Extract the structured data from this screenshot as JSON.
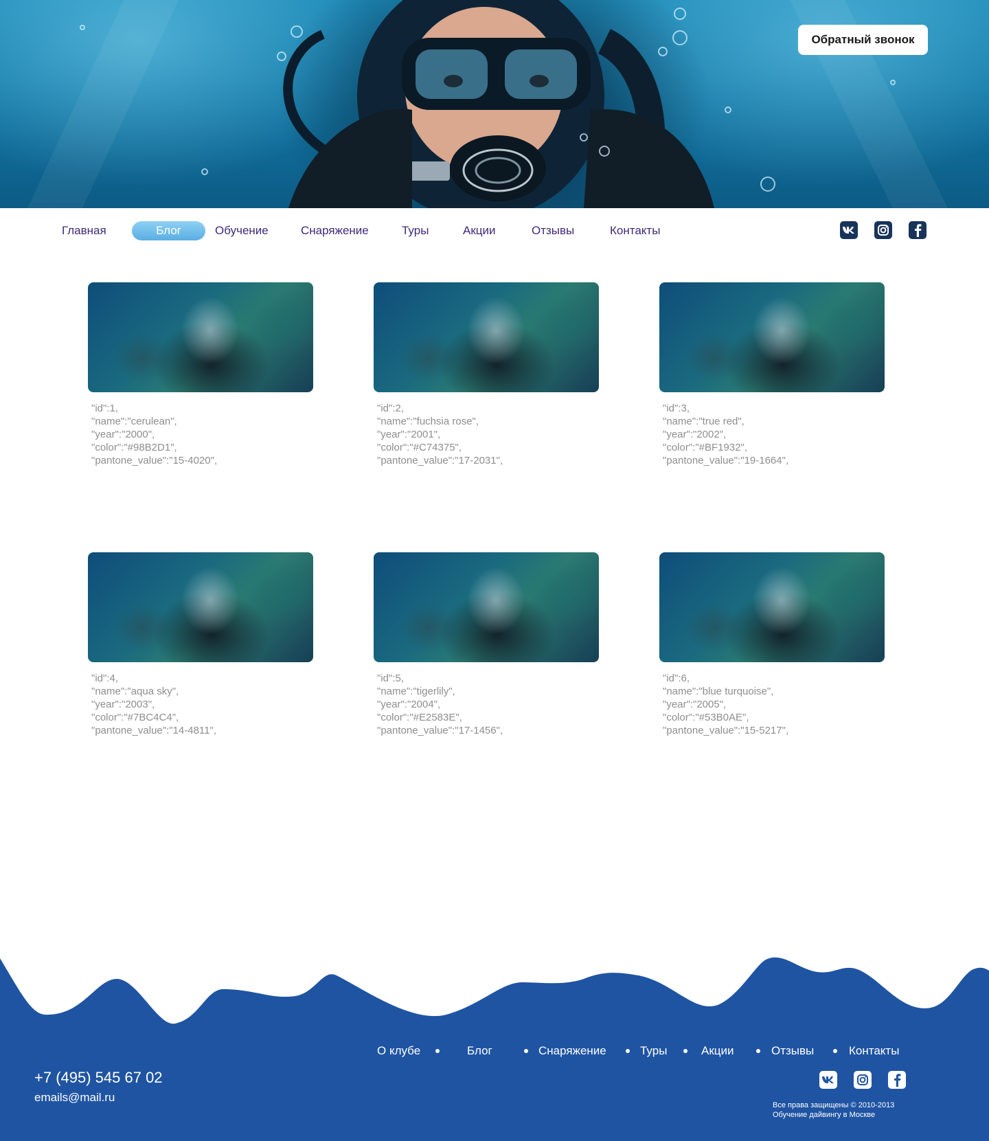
{
  "header": {
    "callback_label": "Обратный звонок"
  },
  "nav": {
    "items": [
      {
        "label": "Главная"
      },
      {
        "label": "Блог",
        "active": true
      },
      {
        "label": "Обучение"
      },
      {
        "label": "Снаряжение"
      },
      {
        "label": "Туры"
      },
      {
        "label": "Акции"
      },
      {
        "label": "Отзывы"
      },
      {
        "label": "Контакты"
      }
    ],
    "social": [
      "vk-icon",
      "instagram-icon",
      "facebook-icon"
    ]
  },
  "cards": [
    {
      "lines": [
        "\"id\":1,",
        "\"name\":\"cerulean\",",
        "\"year\":\"2000\",",
        "\"color\":\"#98B2D1\",",
        "\"pantone_value\":\"15-4020\","
      ]
    },
    {
      "lines": [
        "\"id\":2,",
        "\"name\":\"fuchsia rose\",",
        "\"year\":\"2001\",",
        "\"color\":\"#C74375\",",
        "\"pantone_value\":\"17-2031\","
      ]
    },
    {
      "lines": [
        "\"id\":3,",
        "\"name\":\"true red\",",
        "\"year\":\"2002\",",
        "\"color\":\"#BF1932\",",
        "\"pantone_value\":\"19-1664\","
      ]
    },
    {
      "lines": [
        "\"id\":4,",
        "\"name\":\"aqua sky\",",
        "\"year\":\"2003\",",
        "\"color\":\"#7BC4C4\",",
        "\"pantone_value\":\"14-4811\","
      ]
    },
    {
      "lines": [
        "\"id\":5,",
        "\"name\":\"tigerlily\",",
        "\"year\":\"2004\",",
        "\"color\":\"#E2583E\",",
        "\"pantone_value\":\"17-1456\","
      ]
    },
    {
      "lines": [
        "\"id\":6,",
        "\"name\":\"blue turquoise\",",
        "\"year\":\"2005\",",
        "\"color\":\"#53B0AE\",",
        "\"pantone_value\":\"15-5217\","
      ]
    }
  ],
  "footer": {
    "links": [
      "О клубе",
      "Блог",
      "Снаряжение",
      "Туры",
      "Акции",
      "Отзывы",
      "Контакты"
    ],
    "phone": "+7 (495) 545 67 02",
    "email": "emails@mail.ru",
    "copyright_line1": "Все права защищены © 2010-2013",
    "copyright_line2": "Обучение дайвингу в Москве",
    "social": [
      "vk-icon",
      "instagram-icon",
      "facebook-icon"
    ]
  },
  "colors": {
    "nav_text": "#3d2a7a",
    "nav_active_bg": "#59aee4",
    "footer_bg": "#1f54a2",
    "card_text": "#8e8e8e",
    "icon_dark": "#18345a"
  }
}
